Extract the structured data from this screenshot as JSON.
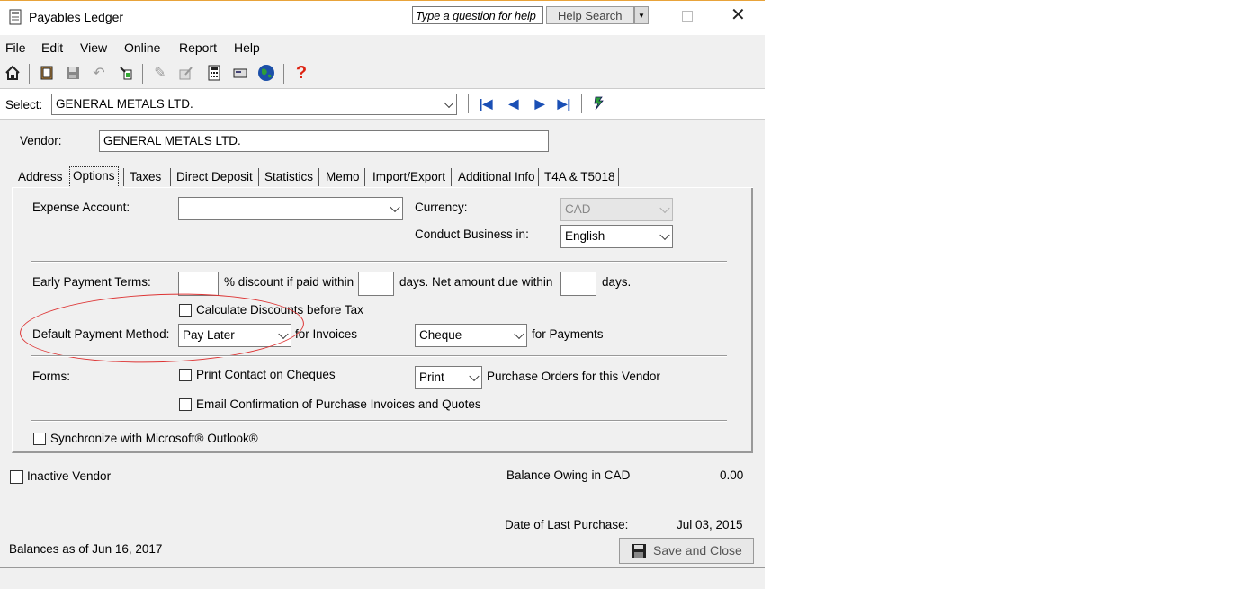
{
  "window": {
    "title": "Payables Ledger"
  },
  "help": {
    "question_placeholder": "Type a question for help",
    "search_label": "Help Search"
  },
  "menu": [
    {
      "label": "File",
      "key": "F"
    },
    {
      "label": "Edit",
      "key": "E"
    },
    {
      "label": "View",
      "key": "V"
    },
    {
      "label": "Online",
      "key": "O"
    },
    {
      "label": "Report",
      "key": "R"
    },
    {
      "label": "Help",
      "key": "H"
    }
  ],
  "toolbar": {
    "icons": [
      "home-icon",
      "open-book-icon",
      "save-icon",
      "undo-icon",
      "recycle-icon",
      "pencil-icon",
      "edit-doc-icon",
      "calculator-icon",
      "email-icon",
      "globe-icon",
      "help-icon"
    ]
  },
  "select": {
    "label": "Select:",
    "value": "GENERAL METALS LTD."
  },
  "vendor": {
    "label": "Vendor:",
    "value": "GENERAL METALS LTD."
  },
  "tabs": [
    "Address",
    "Options",
    "Taxes",
    "Direct Deposit",
    "Statistics",
    "Memo",
    "Import/Export",
    "Additional Info",
    "T4A & T5018"
  ],
  "active_tab": "Options",
  "options": {
    "expense_account_label": "Expense Account:",
    "expense_account_value": "",
    "currency_label": "Currency:",
    "currency_value": "CAD",
    "conduct_label": "Conduct Business in:",
    "conduct_value": "English",
    "early_terms_label": "Early Payment Terms:",
    "discount_text": "% discount if paid within",
    "days_net_text": "days. Net amount due within",
    "days_text": "days.",
    "discount_value": "",
    "within_days_value": "",
    "net_days_value": "",
    "calc_discounts_label": "Calculate Discounts before Tax",
    "default_method_label": "Default Payment Method:",
    "invoice_method_value": "Pay Later",
    "for_invoices": "for Invoices",
    "payment_method_value": "Cheque",
    "for_payments": "for Payments",
    "forms_label": "Forms:",
    "print_contact_label": "Print Contact on Cheques",
    "po_mode_value": "Print",
    "po_text": "Purchase Orders for this Vendor",
    "email_conf_label": "Email Confirmation of Purchase Invoices and Quotes",
    "sync_label": "Synchronize with Microsoft® Outlook®"
  },
  "footer": {
    "inactive_label": "Inactive Vendor",
    "balance_label": "Balance Owing in CAD",
    "balance_value": "0.00",
    "last_purchase_label": "Date of Last Purchase:",
    "last_purchase_value": "Jul 03, 2015",
    "balances_as_of": "Balances as of Jun 16, 2017",
    "save_close": "Save and Close"
  }
}
